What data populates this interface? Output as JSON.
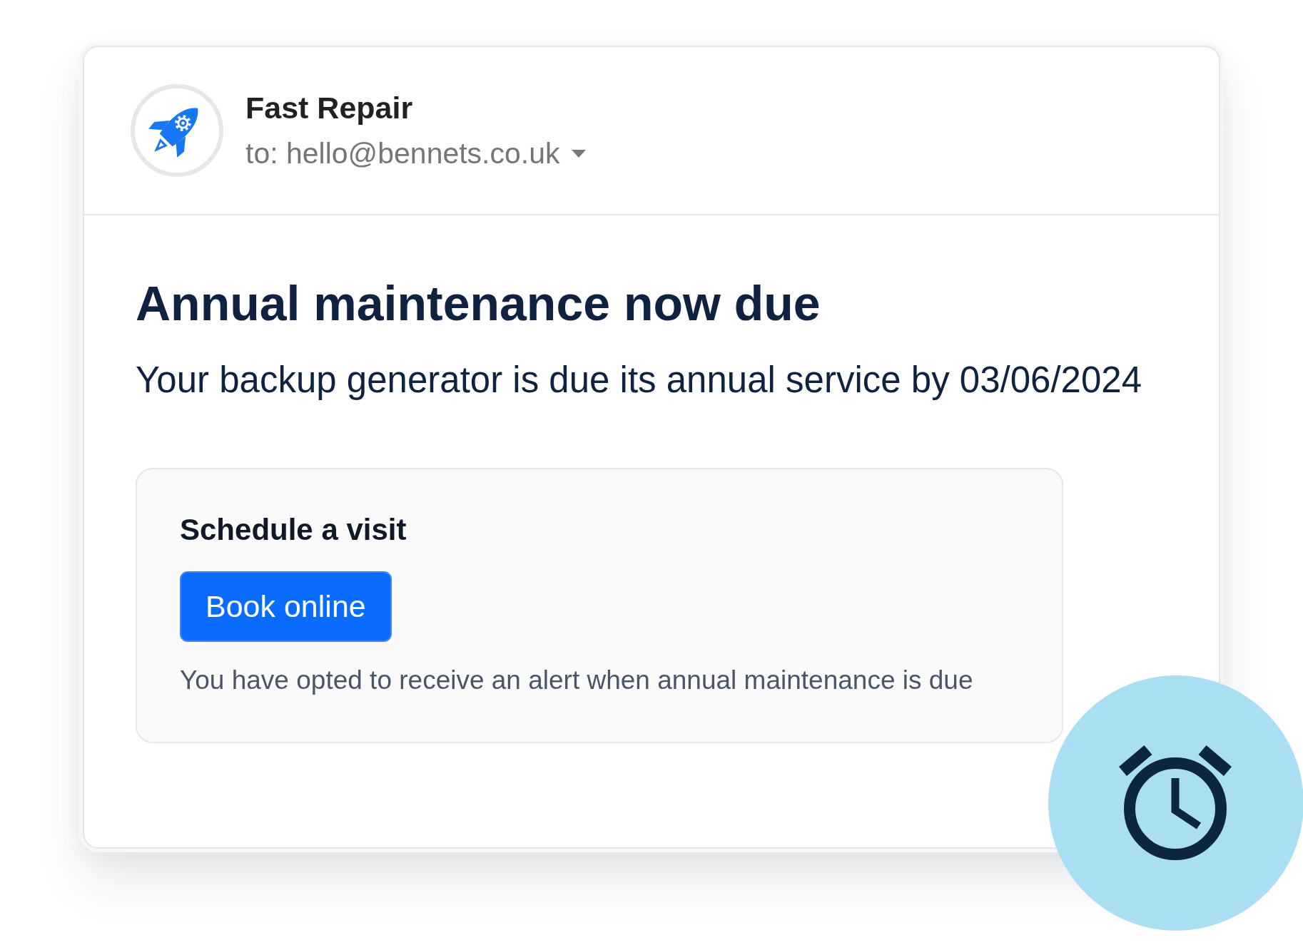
{
  "email": {
    "sender": {
      "name": "Fast Repair",
      "recipient": "to: hello@bennets.co.uk"
    }
  },
  "message": {
    "title": "Annual maintenance now due",
    "body": "Your backup generator is due its annual service by 03/06/2024"
  },
  "action_card": {
    "heading": "Schedule a visit",
    "button": "Book online",
    "note": "You have opted to receive an alert when annual maintenance is due"
  }
}
